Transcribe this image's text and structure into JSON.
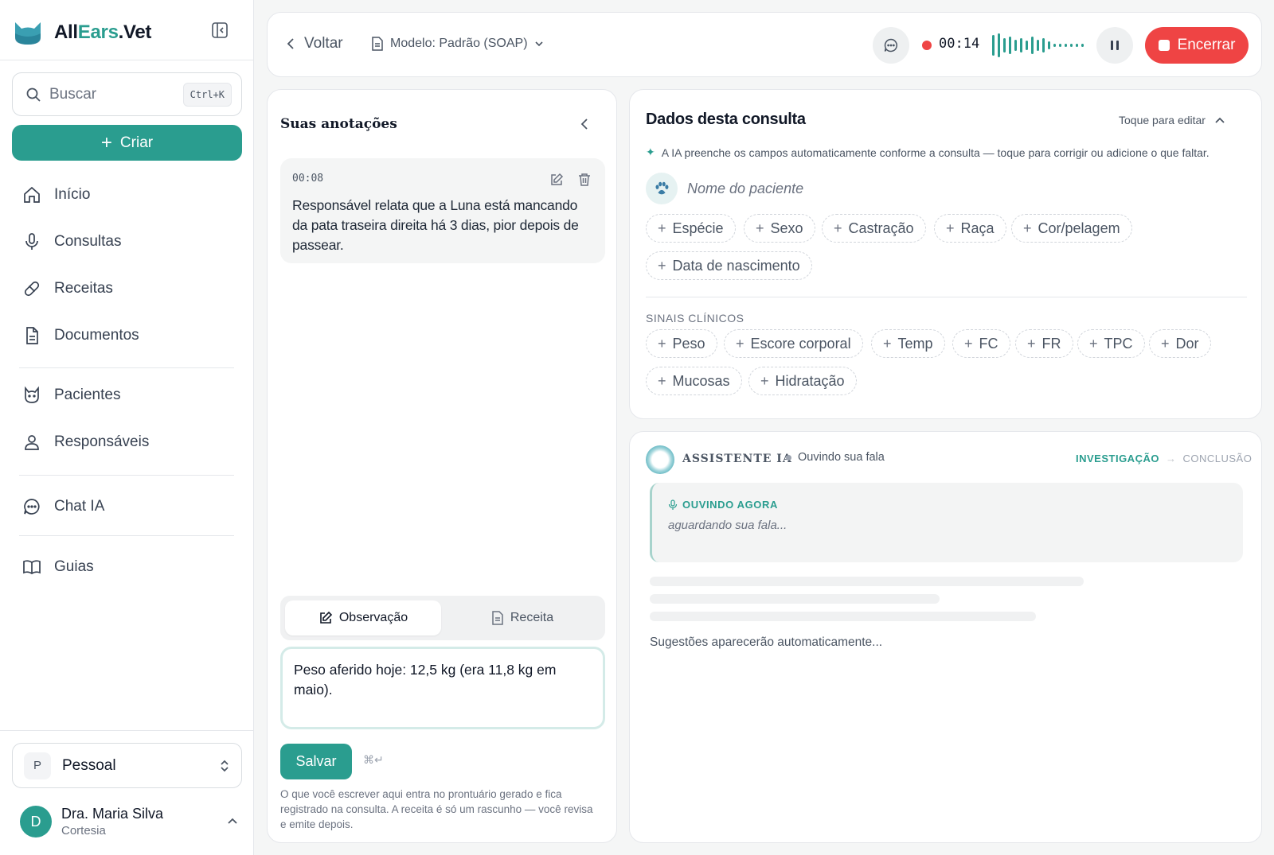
{
  "brand": {
    "prefix": "All",
    "highlight": "Ears",
    "suffix": ".Vet"
  },
  "sidebar": {
    "search": {
      "placeholder": "Buscar",
      "shortcut": "Ctrl+K"
    },
    "create_label": "Criar",
    "nav": [
      {
        "label": "Início",
        "icon": "home-icon"
      },
      {
        "label": "Consultas",
        "icon": "microphone-icon"
      },
      {
        "label": "Receitas",
        "icon": "pill-icon"
      },
      {
        "label": "Documentos",
        "icon": "document-icon"
      },
      {
        "label": "Pacientes",
        "icon": "cat-icon"
      },
      {
        "label": "Responsáveis",
        "icon": "user-icon"
      },
      {
        "label": "Chat IA",
        "icon": "chat-icon"
      },
      {
        "label": "Guias",
        "icon": "book-icon"
      }
    ],
    "workspace": {
      "badge": "P",
      "label": "Pessoal"
    },
    "user": {
      "initial": "D",
      "name": "Dra. Maria Silva",
      "plan": "Cortesia"
    }
  },
  "topbar": {
    "back_label": "Voltar",
    "model_label": "Modelo: Padrão (SOAP)",
    "timer": "00:14",
    "end_label": "Encerrar"
  },
  "notes": {
    "title": "Suas anotações",
    "items": [
      {
        "time": "00:08",
        "text": "Responsável relata que a Luna está mancando da pata traseira direita há 3 dias, pior depois de passear."
      }
    ],
    "tabs": [
      {
        "label": "Observação",
        "active": true
      },
      {
        "label": "Receita",
        "active": false
      }
    ],
    "input_value": "Peso aferido hoje: 12,5 kg (era 11,8 kg em maio).",
    "save_label": "Salvar",
    "shortcut_hint": "⌘↵",
    "hint": "O que você escrever aqui entra no prontuário gerado e fica registrado na consulta. A receita é só um rascunho — você revisa e emite depois."
  },
  "consult": {
    "title": "Dados desta consulta",
    "edit_hint": "Toque para editar",
    "ai_note": "A IA preenche os campos automaticamente conforme a consulta — toque para corrigir ou adicione o que faltar.",
    "patient_placeholder": "Nome do paciente",
    "fields": [
      "Espécie",
      "Sexo",
      "Castração",
      "Raça",
      "Cor/pelagem",
      "Data de nascimento"
    ],
    "signs_label": "SINAIS CLÍNICOS",
    "signs": [
      "Peso",
      "Escore corporal",
      "Temp",
      "FC",
      "FR",
      "TPC",
      "Dor",
      "Mucosas",
      "Hidratação"
    ]
  },
  "assistant": {
    "title": "ASSISTENTE IA",
    "status": "Ouvindo sua fala",
    "phase_current": "INVESTIGAÇÃO",
    "phase_arrow": "→",
    "phase_next": "CONCLUSÃO",
    "listening_label": "OUVINDO AGORA",
    "listening_placeholder": "aguardando sua fala...",
    "suggestions_placeholder": "Sugestões aparecerão automaticamente..."
  },
  "colors": {
    "accent": "#2a9d8f",
    "danger": "#ef4444"
  }
}
